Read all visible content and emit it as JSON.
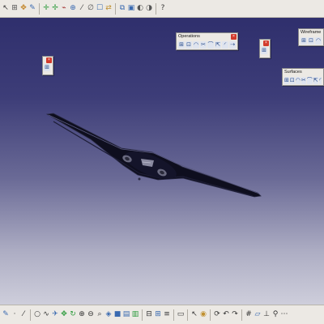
{
  "toolbars": {
    "top": {
      "icons": [
        {
          "name": "select-arrow-icon",
          "glyph": "↖",
          "color": "#333333"
        },
        {
          "name": "snap-icon",
          "glyph": "⊞",
          "color": "#555555"
        },
        {
          "name": "compass-icon",
          "glyph": "✥",
          "color": "#c08020"
        },
        {
          "name": "pen-icon",
          "glyph": "✎",
          "color": "#3a6ab0"
        },
        {
          "name": "separator",
          "glyph": "",
          "color": ""
        },
        {
          "name": "pan-icon",
          "glyph": "✛",
          "color": "#2a9a3a"
        },
        {
          "name": "rotate-icon",
          "glyph": "✢",
          "color": "#2a9a3a"
        },
        {
          "name": "fly-icon",
          "glyph": "⌁",
          "color": "#a03030"
        },
        {
          "name": "zoom-icon",
          "glyph": "⊕",
          "color": "#3a6ab0"
        },
        {
          "name": "sketch-line-icon",
          "glyph": "⁄",
          "color": "#444444"
        },
        {
          "name": "normal-view-icon",
          "glyph": "∅",
          "color": "#555555"
        },
        {
          "name": "multi-view-icon",
          "glyph": "☐",
          "color": "#3a6ab0"
        },
        {
          "name": "swap-icon",
          "glyph": "⇄",
          "color": "#c09030"
        },
        {
          "name": "separator",
          "glyph": "",
          "color": ""
        },
        {
          "name": "view-mode-icon",
          "glyph": "⧉",
          "color": "#3a6ab0"
        },
        {
          "name": "render-style-icon",
          "glyph": "▣",
          "color": "#3a6ab0"
        },
        {
          "name": "hide-show-icon",
          "glyph": "◐",
          "color": "#555555"
        },
        {
          "name": "swap-visible-icon",
          "glyph": "◑",
          "color": "#555555"
        },
        {
          "name": "separator",
          "glyph": "",
          "color": ""
        },
        {
          "name": "help-icon",
          "glyph": "?",
          "color": "#333333"
        }
      ]
    },
    "bottom": {
      "icons": [
        {
          "name": "sketch-icon",
          "glyph": "✎",
          "color": "#3a6ab0"
        },
        {
          "name": "point-icon",
          "glyph": "·",
          "color": "#333333"
        },
        {
          "name": "line-icon",
          "glyph": "⁄",
          "color": "#333333"
        },
        {
          "name": "separator",
          "glyph": "",
          "color": ""
        },
        {
          "name": "circle-icon",
          "glyph": "○",
          "color": "#333333"
        },
        {
          "name": "spline-icon",
          "glyph": "∿",
          "color": "#333333"
        },
        {
          "name": "fly-mode-icon",
          "glyph": "✈",
          "color": "#3a6ab0"
        },
        {
          "name": "pan-icon",
          "glyph": "✥",
          "color": "#2a9a3a"
        },
        {
          "name": "rotate-icon",
          "glyph": "↻",
          "color": "#2a9a3a"
        },
        {
          "name": "zoom-in-icon",
          "glyph": "⊕",
          "color": "#333333"
        },
        {
          "name": "zoom-out-icon",
          "glyph": "⊖",
          "color": "#333333"
        },
        {
          "name": "normal-view-icon",
          "glyph": "⌕",
          "color": "#333333"
        },
        {
          "name": "iso-view-icon",
          "glyph": "◈",
          "color": "#3a6ab0"
        },
        {
          "name": "shading-icon",
          "glyph": "■",
          "color": "#3a6ab0"
        },
        {
          "name": "hide-show-icon",
          "glyph": "▤",
          "color": "#3a6ab0"
        },
        {
          "name": "swap-visible-icon",
          "glyph": "▥",
          "color": "#2a9a3a"
        },
        {
          "name": "separator",
          "glyph": "",
          "color": ""
        },
        {
          "name": "measure-icon",
          "glyph": "⊟",
          "color": "#333333"
        },
        {
          "name": "analysis-icon",
          "glyph": "⊞",
          "color": "#3a6ab0"
        },
        {
          "name": "tree-icon",
          "glyph": "≡",
          "color": "#333333"
        },
        {
          "name": "separator",
          "glyph": "",
          "color": ""
        },
        {
          "name": "camera-icon",
          "glyph": "▭",
          "color": "#333333"
        },
        {
          "name": "separator",
          "glyph": "",
          "color": ""
        },
        {
          "name": "select-icon",
          "glyph": "↖",
          "color": "#333333"
        },
        {
          "name": "apply-material-icon",
          "glyph": "◉",
          "color": "#c09030"
        },
        {
          "name": "separator",
          "glyph": "",
          "color": ""
        },
        {
          "name": "update-icon",
          "glyph": "⟳",
          "color": "#333333"
        },
        {
          "name": "undo-icon",
          "glyph": "↶",
          "color": "#333333"
        },
        {
          "name": "redo-icon",
          "glyph": "↷",
          "color": "#333333"
        },
        {
          "name": "separator",
          "glyph": "",
          "color": ""
        },
        {
          "name": "grid-icon",
          "glyph": "#",
          "color": "#333333"
        },
        {
          "name": "plane-icon",
          "glyph": "▱",
          "color": "#3a6ab0"
        },
        {
          "name": "axis-icon",
          "glyph": "⊥",
          "color": "#333333"
        },
        {
          "name": "constraint-icon",
          "glyph": "⚲",
          "color": "#333333"
        },
        {
          "name": "properties-icon",
          "glyph": "⋯",
          "color": "#333333"
        }
      ]
    }
  },
  "palettes": {
    "operations": {
      "title": "Operations",
      "icons": [
        "join-icon",
        "healing-icon",
        "split-icon",
        "trim-icon",
        "boundary-icon",
        "extract-icon",
        "fillet-icon",
        "translate-icon"
      ]
    },
    "wireframe": {
      "title": "Wireframe",
      "icons": [
        "point-icon",
        "line-icon",
        "plane-icon"
      ]
    },
    "surfaces": {
      "title": "Surfaces",
      "icons": [
        "extrude-icon",
        "revolve-icon",
        "sphere-icon",
        "offset-icon",
        "sweep-icon",
        "fill-icon",
        "multi-section-icon"
      ]
    },
    "small_left": {
      "icons": [
        "sketcher-icon"
      ]
    },
    "small_right": {
      "icons": [
        "exit-workbench-icon"
      ]
    }
  },
  "colors": {
    "background_top": "#2c2c6a",
    "background_bottom": "#dadae4",
    "toolbar_bg": "#ece9e4",
    "close_red": "#d23a2c",
    "plane_body": "#0e0e1e"
  }
}
